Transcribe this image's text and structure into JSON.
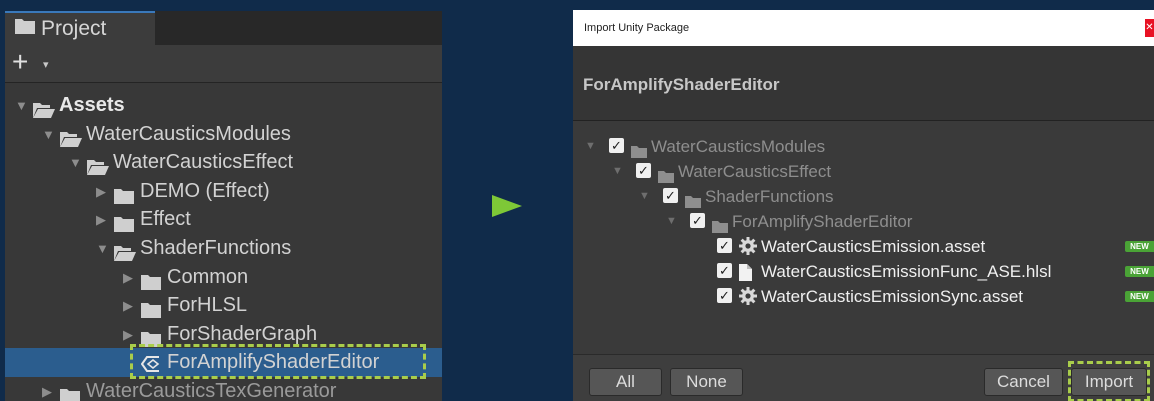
{
  "project": {
    "tab_label": "Project",
    "toolbar": {
      "add_label": "+",
      "add_dropdown": "▾"
    },
    "tree": [
      {
        "label": "Assets",
        "level": 0,
        "expanded": true,
        "kind": "folder",
        "bold": true
      },
      {
        "label": "WaterCausticsModules",
        "level": 1,
        "expanded": true,
        "kind": "folder"
      },
      {
        "label": "WaterCausticsEffect",
        "level": 2,
        "expanded": true,
        "kind": "folder"
      },
      {
        "label": "DEMO (Effect)",
        "level": 3,
        "expanded": false,
        "kind": "folder"
      },
      {
        "label": "Effect",
        "level": 3,
        "expanded": false,
        "kind": "folder"
      },
      {
        "label": "ShaderFunctions",
        "level": 3,
        "expanded": true,
        "kind": "folder"
      },
      {
        "label": "Common",
        "level": 4,
        "expanded": false,
        "kind": "folder"
      },
      {
        "label": "ForHLSL",
        "level": 4,
        "expanded": false,
        "kind": "folder"
      },
      {
        "label": "ForShaderGraph",
        "level": 4,
        "expanded": false,
        "kind": "folder"
      },
      {
        "label": "ForAmplifyShaderEditor",
        "level": 4,
        "kind": "unitypackage",
        "selected": true
      },
      {
        "label": "WaterCausticsTexGenerator",
        "level": 1,
        "expanded": false,
        "kind": "folder",
        "dim": true
      }
    ]
  },
  "dialog": {
    "title": "Import Unity Package",
    "close_label": "✕",
    "package_name": "ForAmplifyShaderEditor",
    "items": [
      {
        "label": "WaterCausticsModules",
        "level": 0,
        "kind": "folder",
        "dim": true,
        "checked": true
      },
      {
        "label": "WaterCausticsEffect",
        "level": 1,
        "kind": "folder",
        "dim": true,
        "checked": true
      },
      {
        "label": "ShaderFunctions",
        "level": 2,
        "kind": "folder",
        "dim": true,
        "checked": true
      },
      {
        "label": "ForAmplifyShaderEditor",
        "level": 3,
        "kind": "folder",
        "dim": true,
        "checked": true
      },
      {
        "label": "WaterCausticsEmission.asset",
        "level": 4,
        "kind": "asset",
        "checked": true,
        "badge": "NEW"
      },
      {
        "label": "WaterCausticsEmissionFunc_ASE.hlsl",
        "level": 4,
        "kind": "file",
        "checked": true,
        "badge": "NEW"
      },
      {
        "label": "WaterCausticsEmissionSync.asset",
        "level": 4,
        "kind": "asset",
        "checked": true,
        "badge": "NEW"
      }
    ],
    "buttons": {
      "all": "All",
      "none": "None",
      "cancel": "Cancel",
      "import": "Import"
    }
  },
  "colors": {
    "background": "#102b4a",
    "selection": "#2b5d8e",
    "highlight": "#a9cd4b",
    "new_badge": "#4aa336",
    "arrow": "#7ec837"
  }
}
